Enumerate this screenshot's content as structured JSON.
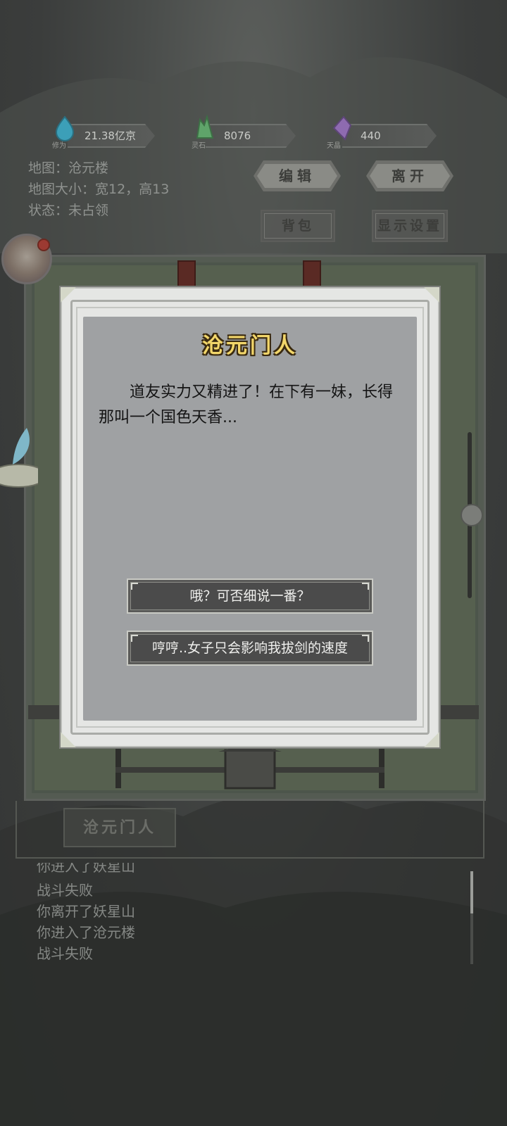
{
  "resources": [
    {
      "label": "修为",
      "value": "21.38亿京",
      "color": "#3c9fb8",
      "icon": "water-drop-icon"
    },
    {
      "label": "灵石",
      "value": "8076",
      "color": "#5fa46a",
      "icon": "crystal-icon"
    },
    {
      "label": "天晶",
      "value": "440",
      "color": "#8e6bb0",
      "icon": "purple-gem-icon"
    }
  ],
  "map_info": {
    "map": "地图：沧元楼",
    "size": "地图大小：宽12，高13",
    "status": "状态：未占领"
  },
  "buttons": {
    "edit": "编辑",
    "leave": "离开",
    "bag": "背包",
    "display_settings": "显示设置"
  },
  "npc_tab": "沧元门人",
  "dialog": {
    "speaker": "沧元门人",
    "text": "道友实力又精进了！在下有一妹，长得那叫一个国色天香...",
    "choices": [
      "哦？可否细说一番？",
      "哼哼..女子只会影响我拔剑的速度"
    ]
  },
  "log": {
    "partial": "你进入了妖星山",
    "entries": [
      "战斗失败",
      "你离开了妖星山",
      "你进入了沧元楼",
      "战斗失败"
    ]
  }
}
